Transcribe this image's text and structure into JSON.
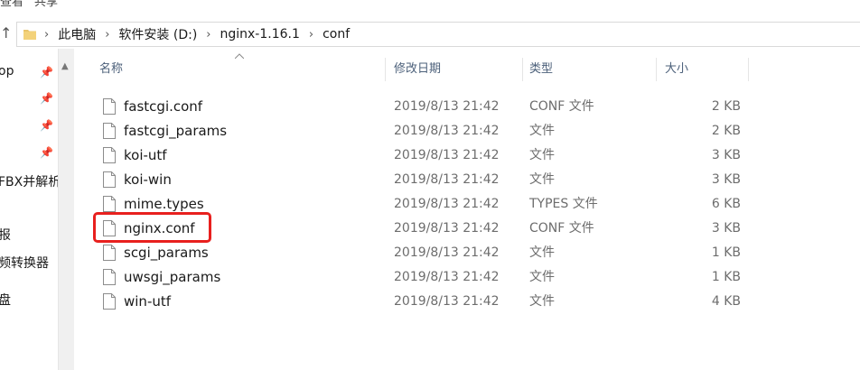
{
  "ribbon": {
    "tabs": [
      "查看",
      "共享"
    ]
  },
  "address": {
    "crumbs": [
      "此电脑",
      "软件安装 (D:)",
      "nginx-1.16.1",
      "conf"
    ],
    "separator": "›"
  },
  "nav": {
    "items": [
      "op",
      "FBX并解析",
      "报",
      "频转换器",
      "盘"
    ]
  },
  "columns": {
    "name": "名称",
    "date": "修改日期",
    "type": "类型",
    "size": "大小"
  },
  "files": [
    {
      "name": "fastcgi.conf",
      "date": "2019/8/13 21:42",
      "type": "CONF 文件",
      "size": "2 KB"
    },
    {
      "name": "fastcgi_params",
      "date": "2019/8/13 21:42",
      "type": "文件",
      "size": "2 KB"
    },
    {
      "name": "koi-utf",
      "date": "2019/8/13 21:42",
      "type": "文件",
      "size": "3 KB"
    },
    {
      "name": "koi-win",
      "date": "2019/8/13 21:42",
      "type": "文件",
      "size": "3 KB"
    },
    {
      "name": "mime.types",
      "date": "2019/8/13 21:42",
      "type": "TYPES 文件",
      "size": "6 KB"
    },
    {
      "name": "nginx.conf",
      "date": "2019/8/13 21:42",
      "type": "CONF 文件",
      "size": "3 KB"
    },
    {
      "name": "scgi_params",
      "date": "2019/8/13 21:42",
      "type": "文件",
      "size": "1 KB"
    },
    {
      "name": "uwsgi_params",
      "date": "2019/8/13 21:42",
      "type": "文件",
      "size": "1 KB"
    },
    {
      "name": "win-utf",
      "date": "2019/8/13 21:42",
      "type": "文件",
      "size": "4 KB"
    }
  ],
  "highlighted_file": "nginx.conf",
  "colors": {
    "highlight": "#e8201e",
    "header_text": "#4c607a",
    "folder": "#e9c46a"
  }
}
